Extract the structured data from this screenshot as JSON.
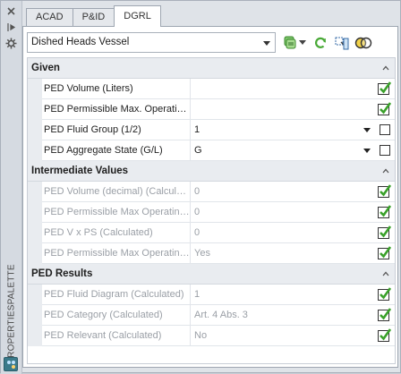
{
  "palette": {
    "vertical_title": "PROPERTIESPALETTE"
  },
  "tabs": [
    {
      "label": "ACAD",
      "active": false
    },
    {
      "label": "P&ID",
      "active": false
    },
    {
      "label": "DGRL",
      "active": true
    }
  ],
  "toolbar": {
    "selected_object": "Dished Heads Vessel"
  },
  "categories": {
    "given": {
      "title": "Given",
      "rows": [
        {
          "name": "PED Volume (Liters)",
          "value": "",
          "control": "check"
        },
        {
          "name": "PED Permissible Max. Operating...",
          "value": "",
          "control": "check"
        },
        {
          "name": "PED Fluid Group (1/2)",
          "value": "1",
          "control": "dropdown-checkbox"
        },
        {
          "name": "PED Aggregate State (G/L)",
          "value": "G",
          "control": "dropdown-checkbox"
        }
      ]
    },
    "intermediate": {
      "title": "Intermediate Values",
      "rows": [
        {
          "name": "PED Volume (decimal) (Calculat...",
          "value": "0",
          "control": "check"
        },
        {
          "name": "PED Permissible Max Operating ...",
          "value": "0",
          "control": "check"
        },
        {
          "name": "PED V x PS (Calculated)",
          "value": "0",
          "control": "check"
        },
        {
          "name": "PED Permissible Max Operating ...",
          "value": "Yes",
          "control": "check"
        }
      ]
    },
    "results": {
      "title": "PED Results",
      "rows": [
        {
          "name": "PED Fluid Diagram (Calculated)",
          "value": "1",
          "control": "check"
        },
        {
          "name": "PED Category (Calculated)",
          "value": "Art. 4 Abs. 3",
          "control": "check"
        },
        {
          "name": "PED Relevant (Calculated)",
          "value": "No",
          "control": "check"
        }
      ]
    }
  },
  "colors": {
    "check_green": "#3aa12a",
    "category_bg": "#e9ecf0",
    "readonly_text": "#9a9fa6"
  },
  "icons": [
    "close-icon",
    "auto-hide-icon",
    "settings-icon",
    "quick-select-icon",
    "refresh-icon",
    "select-objects-icon",
    "toggle-pickadd-icon",
    "collapse-icon"
  ]
}
